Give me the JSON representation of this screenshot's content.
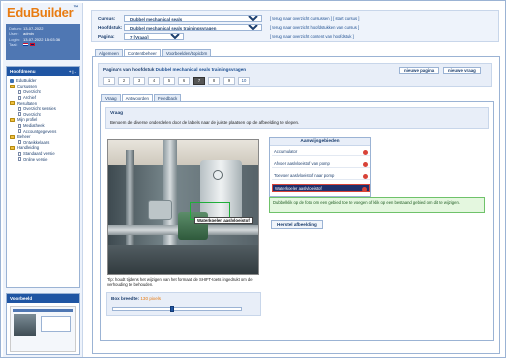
{
  "app": {
    "logo_text": "EduBuilder",
    "logo_mark": "™"
  },
  "user": {
    "rows": [
      {
        "key": "Datum:",
        "value": "13-07-2022"
      },
      {
        "key": "User:",
        "value": "admin"
      },
      {
        "key": "Login:",
        "value": "13-07-2022 15:03:36"
      },
      {
        "key": "Taal:",
        "value": ""
      }
    ]
  },
  "menu": {
    "title": "Hoofdmenu",
    "controls": "+ | -",
    "items": [
      {
        "label": "EduBuilder",
        "type": "root"
      },
      {
        "label": "Cursussen",
        "type": "folder"
      },
      {
        "label": "Overzicht",
        "type": "sub"
      },
      {
        "label": "Archief",
        "type": "sub"
      },
      {
        "label": "Resultaten",
        "type": "folder"
      },
      {
        "label": "Overzicht sessies",
        "type": "sub"
      },
      {
        "label": "Overzicht",
        "type": "sub"
      },
      {
        "label": "Mijn profiel",
        "type": "folder"
      },
      {
        "label": "Mediatheek",
        "type": "sub"
      },
      {
        "label": "Accountgegevens",
        "type": "sub"
      },
      {
        "label": "Beheer",
        "type": "folder"
      },
      {
        "label": "Ontwikkelaars",
        "type": "sub"
      },
      {
        "label": "Handleiding",
        "type": "folder"
      },
      {
        "label": "Standaard versie",
        "type": "sub"
      },
      {
        "label": "Online versie",
        "type": "sub"
      }
    ]
  },
  "preview": {
    "title": "Voorbeeld"
  },
  "form": {
    "cursus_label": "Cursus:",
    "cursus_value": "Dubbel mechanical seals",
    "cursus_links": "[ terug naar overzicht cursussen ] [ start cursus ]",
    "hoofdstuk_label": "Hoofdstuk:",
    "hoofdstuk_value": "Dubbel mechanical seals trainingsvragen",
    "hoofdstuk_links": "[ terug naar overzicht hoofdstukken van cursus ]",
    "pagina_label": "Pagina:",
    "pagina_value": "7 [Vraag]",
    "pagina_links": "[ terug naar overzicht content van hoofdstuk ]"
  },
  "main_tabs": [
    "Algemeen",
    "Contentbeheer",
    "Voorbeelden/topicbrn"
  ],
  "pages_bar": {
    "title_prefix": "Pagina's van hoofdstuk",
    "title_chapter": "Dubbel mechanical seals trainingsvragen",
    "new_page": "nieuwe pagina",
    "new_question": "nieuwe vraag",
    "numbers": [
      "1",
      "2",
      "3",
      "4",
      "5",
      "6",
      "7",
      "8",
      "9",
      "10"
    ],
    "current": "7"
  },
  "sub_tabs": [
    "Vraag",
    "Antwoorden",
    "Feedback"
  ],
  "question": {
    "heading": "Vraag",
    "text": "Benoem de diverse onderdelen door de labels naar de juiste plaatsen op de afbeelding te slepen."
  },
  "hotspot_label": "Waterkoeler aaslvloeistof",
  "tip": "Tip: houdt tijdens het wijzigen van het formaat de SHIFT-toets ingedrukt om de verhouding te behouden.",
  "box_size": {
    "label": "Box breedte:",
    "value": "130 pixels",
    "slider_fraction": 0.45
  },
  "answers": {
    "heading": "Aanwijsgebieden",
    "items": [
      {
        "label": "Accumulator",
        "selected": false
      },
      {
        "label": "Afvoer aaslvloeistof van pomp",
        "selected": false
      },
      {
        "label": "Toevoer aaslvloeistof naar pomp",
        "selected": false
      },
      {
        "label": "Waterkoeler aaslvloeistof",
        "selected": true
      }
    ]
  },
  "feedback_text": "Dubbelklik op de foto om een gebied toe te voegen of klik op een bestaand gebied om dit te wijzigen.",
  "reset_button": "Herstel afbeelding",
  "colors": {
    "accent": "#1f55a3",
    "logo": "#e87c12",
    "hotspot": "#1fae3a",
    "delete": "#d84338"
  }
}
